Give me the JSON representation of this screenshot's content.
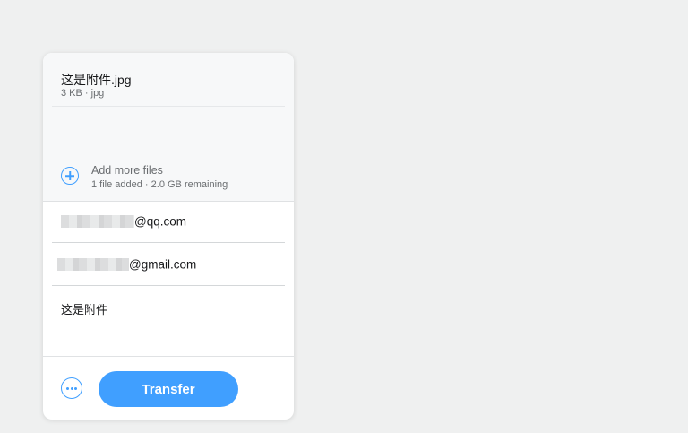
{
  "files": {
    "items": [
      {
        "name": "这是附件.jpg",
        "meta": "3 KB · jpg"
      }
    ],
    "add_more": {
      "title": "Add more files",
      "subtitle": "1 file added · 2.0 GB remaining"
    }
  },
  "recipients": [
    {
      "visible_suffix": "@qq.com"
    },
    {
      "visible_suffix": "@gmail.com"
    }
  ],
  "message": {
    "value": "这是附件"
  },
  "footer": {
    "more_icon": "more-options-icon",
    "transfer_label": "Transfer"
  },
  "colors": {
    "accent": "#409fff",
    "background": "#eff0f0",
    "panel": "#ffffff",
    "files_area": "#f7f8f9"
  }
}
